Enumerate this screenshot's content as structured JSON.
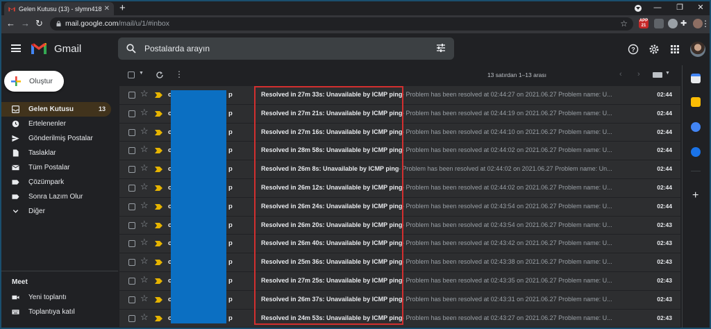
{
  "browser": {
    "tab_title": "Gelen Kutusu (13) - slymn4181@",
    "new_tab_label": "+",
    "url_host": "mail.google.com",
    "url_path": "/mail/u/1/#inbox",
    "ext_badge": "APP",
    "ext_badge_count": "21"
  },
  "header": {
    "app_name": "Gmail",
    "search_placeholder": "Postalarda arayın"
  },
  "sidebar": {
    "compose_label": "Oluştur",
    "items": [
      {
        "label": "Gelen Kutusu",
        "count": "13",
        "icon": "inbox-icon",
        "active": true
      },
      {
        "label": "Ertelenenler",
        "icon": "clock-icon"
      },
      {
        "label": "Gönderilmiş Postalar",
        "icon": "send-icon"
      },
      {
        "label": "Taslaklar",
        "icon": "draft-icon"
      },
      {
        "label": "Tüm Postalar",
        "icon": "mail-icon"
      },
      {
        "label": "Çözümpark",
        "icon": "label-icon"
      },
      {
        "label": "Sonra Lazım Olur",
        "icon": "label-icon"
      },
      {
        "label": "Diğer",
        "icon": "chevron-down-icon"
      }
    ],
    "meet": {
      "title": "Meet",
      "items": [
        {
          "label": "Yeni toplantı",
          "icon": "video-icon"
        },
        {
          "label": "Toplantıya katıl",
          "icon": "keyboard-icon"
        }
      ]
    }
  },
  "toolbar": {
    "pager_text": "13 satırdan 1–13 arası"
  },
  "emails": [
    {
      "sender_start": "c",
      "sender_end": "p",
      "subject": "Resolved in 27m 33s: Unavailable by ICMP ping",
      "snippet": " - Problem has been resolved at 02:44:27 on 2021.06.27 Problem name: U...",
      "time": "02:44"
    },
    {
      "sender_start": "c",
      "sender_end": "p",
      "subject": "Resolved in 27m 21s: Unavailable by ICMP ping",
      "snippet": " - Problem has been resolved at 02:44:19 on 2021.06.27 Problem name: U...",
      "time": "02:44"
    },
    {
      "sender_start": "c",
      "sender_end": "p",
      "subject": "Resolved in 27m 16s: Unavailable by ICMP ping",
      "snippet": " - Problem has been resolved at 02:44:10 on 2021.06.27 Problem name: U...",
      "time": "02:44"
    },
    {
      "sender_start": "c",
      "sender_end": "p",
      "subject": "Resolved in 28m 58s: Unavailable by ICMP ping",
      "snippet": " - Problem has been resolved at 02:44:02 on 2021.06.27 Problem name: U...",
      "time": "02:44"
    },
    {
      "sender_start": "c",
      "sender_end": "p",
      "subject": "Resolved in 26m 8s: Unavailable by ICMP ping",
      "snippet": " - Problem has been resolved at 02:44:02 on 2021.06.27 Problem name: Un...",
      "time": "02:44"
    },
    {
      "sender_start": "c",
      "sender_end": "p",
      "subject": "Resolved in 26m 12s: Unavailable by ICMP ping",
      "snippet": " - Problem has been resolved at 02:44:02 on 2021.06.27 Problem name: U...",
      "time": "02:44"
    },
    {
      "sender_start": "c",
      "sender_end": "p",
      "subject": "Resolved in 26m 24s: Unavailable by ICMP ping",
      "snippet": " - Problem has been resolved at 02:43:54 on 2021.06.27 Problem name: U...",
      "time": "02:44"
    },
    {
      "sender_start": "c",
      "sender_end": "p",
      "subject": "Resolved in 26m 20s: Unavailable by ICMP ping",
      "snippet": " - Problem has been resolved at 02:43:54 on 2021.06.27 Problem name: U...",
      "time": "02:43"
    },
    {
      "sender_start": "c",
      "sender_end": "p",
      "subject": "Resolved in 26m 40s: Unavailable by ICMP ping",
      "snippet": " - Problem has been resolved at 02:43:42 on 2021.06.27 Problem name: U...",
      "time": "02:43"
    },
    {
      "sender_start": "c",
      "sender_end": "p",
      "subject": "Resolved in 25m 36s: Unavailable by ICMP ping",
      "snippet": " - Problem has been resolved at 02:43:38 on 2021.06.27 Problem name: U...",
      "time": "02:43"
    },
    {
      "sender_start": "c",
      "sender_end": "p",
      "subject": "Resolved in 27m 25s: Unavailable by ICMP ping",
      "snippet": " - Problem has been resolved at 02:43:35 on 2021.06.27 Problem name: U...",
      "time": "02:43"
    },
    {
      "sender_start": "c",
      "sender_end": "p",
      "subject": "Resolved in 26m 37s: Unavailable by ICMP ping",
      "snippet": " - Problem has been resolved at 02:43:31 on 2021.06.27 Problem name: U...",
      "time": "02:43"
    },
    {
      "sender_start": "c",
      "sender_end": "p",
      "subject": "Resolved in 24m 53s: Unavailable by ICMP ping",
      "snippet": " - Problem has been resolved at 02:43:27 on 2021.06.27 Problem name: U...",
      "time": "02:43"
    }
  ],
  "colors": {
    "accent_active": "#41331c",
    "importance_marker": "#e6b400",
    "redaction": "#0b6fc2",
    "highlight_border": "#d32f2f"
  }
}
